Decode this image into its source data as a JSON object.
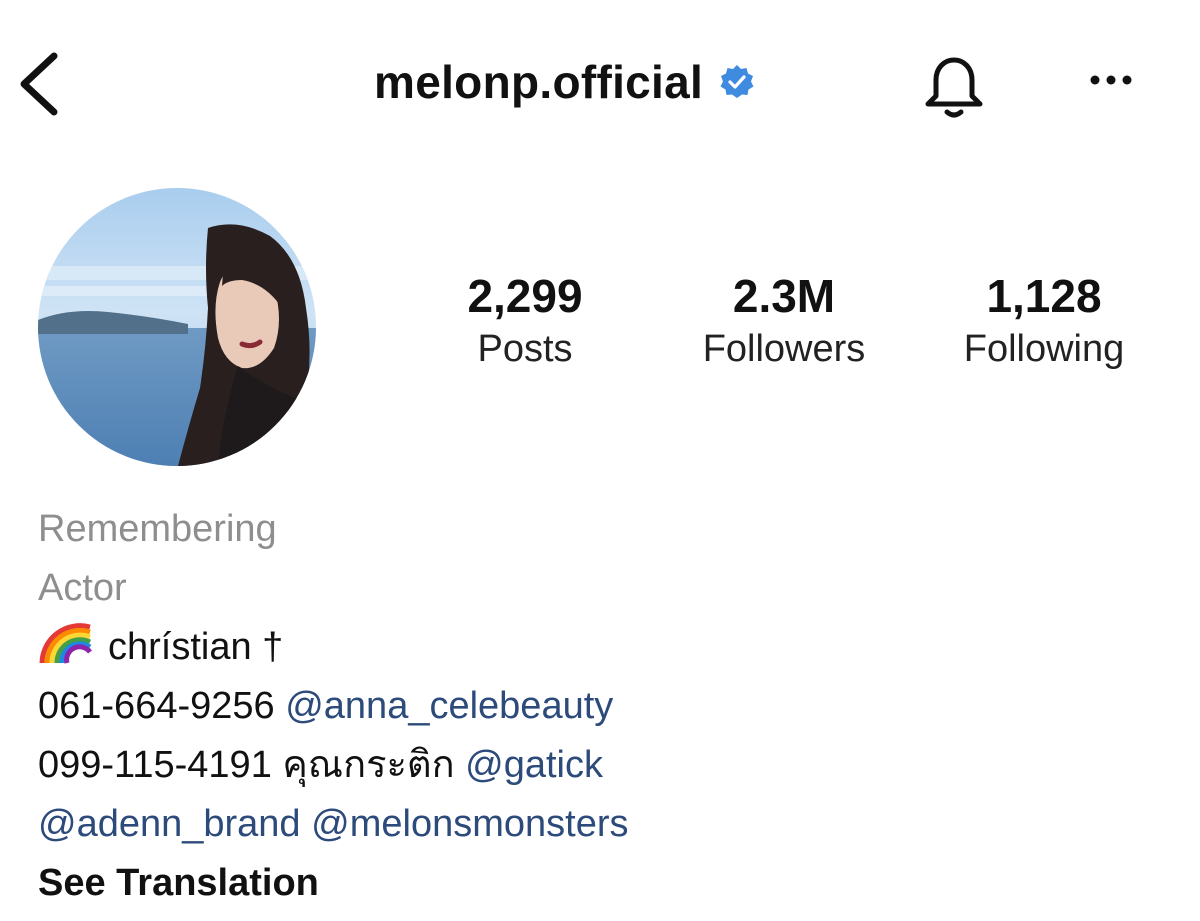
{
  "header": {
    "username": "melonp.official",
    "back_icon": "chevron-left-icon",
    "verified_icon": "verified-badge-icon",
    "bell_icon": "bell-icon",
    "more_icon": "more-dots-icon",
    "verified_color": "#3897f0"
  },
  "stats": {
    "posts": {
      "value": "2,299",
      "label": "Posts"
    },
    "followers": {
      "value": "2.3M",
      "label": "Followers"
    },
    "following": {
      "value": "1,128",
      "label": "Following"
    }
  },
  "bio": {
    "line1": "Remembering",
    "line2": "Actor",
    "line3_emoji": "rainbow-icon",
    "line3_text": "chrístian †",
    "line4_phone": "061-664-9256",
    "line4_mention": "@anna_celebeauty",
    "line5_phone": "099-115-4191",
    "line5_thai": "คุณกระติก",
    "line5_mention": "@gatick",
    "line6_mention1": "@adenn_brand",
    "line6_mention2": "@melonsmonsters",
    "see_translation": "See Translation"
  },
  "colors": {
    "mention": "#2c4a7a",
    "muted": "#8e8e8e"
  }
}
